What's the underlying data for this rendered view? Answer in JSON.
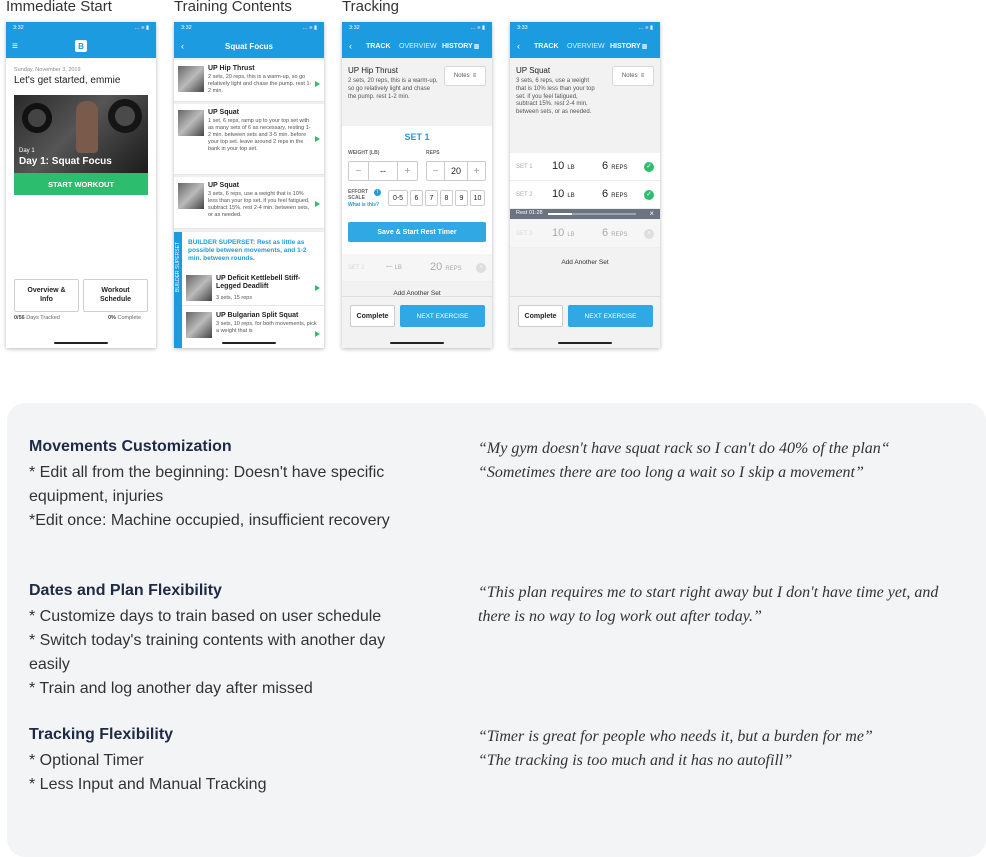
{
  "columns": {
    "col1": "Immediate Start",
    "col2": "Training Contents",
    "col3": "Tracking"
  },
  "status": {
    "time1": "3:32",
    "time2": "3:32",
    "time3": "3:32",
    "time4": "3:33",
    "signal": "… ≡ ▮"
  },
  "phone1": {
    "date": "Sunday, November 3, 2019",
    "greeting": "Let's get started, emmie",
    "day_number": "Day 1",
    "day_title": "Day 1: Squat Focus",
    "start_button": "START WORKOUT",
    "overview_button": "Overview &\nInfo",
    "schedule_button": "Workout\nSchedule",
    "days_tracked_value": "0/56",
    "days_tracked_label": " Days Tracked",
    "complete_value": "0%",
    "complete_label": " Complete"
  },
  "phone2": {
    "title": "Squat Focus",
    "exercises": [
      {
        "name": "UP Hip Thrust",
        "desc": "2 sets, 20 reps, this is a warm-up, so go relatively light and chase the pump. rest 1-2 min."
      },
      {
        "name": "UP Squat",
        "desc": "1 set, 6 reps, ramp up to your top set with as many sets of 6 as necessary, resting 1-2 min. between sets and 3-5 min. before your top set. leave around 2 reps in the bank in your top set."
      },
      {
        "name": "UP Squat",
        "desc": "3 sets, 6 reps, use a weight that is 10% less than your top set. if you feel fatigued, subtract 15%. rest 2-4 min. between sets, or as needed."
      }
    ],
    "superset_side": "BUILDER SUPERSET",
    "superset_header": "BUILDER SUPERSET: Rest as little as possible between movements, and 1-2 min. between rounds.",
    "superset_items": [
      {
        "name": "UP Deficit Kettlebell Stiff-Legged Deadlift",
        "desc": "3 sets, 15 reps"
      },
      {
        "name": "UP Bulgarian Split Squat",
        "desc": "3 sets, 10 reps, for both movements, pick a weight that is"
      }
    ]
  },
  "phone3": {
    "tab_track": "TRACK",
    "tab_overview": "OVERVIEW",
    "tab_history": "HISTORY",
    "exercise_name": "UP Hip Thrust",
    "exercise_desc": "2 sets, 20 reps, this is a warm-up, so go relatively light and chase the pump. rest 1-2 min.",
    "notes": "Notes",
    "set_title": "SET 1",
    "weight_label": "WEIGHT (LB)",
    "reps_label": "REPS",
    "weight_value": "--",
    "reps_value": "20",
    "minus": "−",
    "plus": "+",
    "effort_label": "EFFORT\nSCALE",
    "effort_link": "What is this?",
    "effort_options": [
      "0-5",
      "6",
      "7",
      "8",
      "9",
      "10"
    ],
    "save_button": "Save & Start Rest Timer",
    "set2_label": "SET 2",
    "set2_weight": "--",
    "set2_weight_unit": "LB",
    "set2_reps": "20",
    "set2_reps_unit": "REPS",
    "add_set": "Add Another Set",
    "complete_button": "Complete",
    "next_button": "NEXT EXERCISE"
  },
  "phone4": {
    "tab_track": "TRACK",
    "tab_overview": "OVERVIEW",
    "tab_history": "HISTORY",
    "exercise_name": "UP Squat",
    "exercise_desc": "3 sets, 6 reps, use a weight that is 10% less than your top set. if you feel fatigued, subtract 15%. rest 2-4 min. between sets, or as needed.",
    "notes": "Notes",
    "sets": [
      {
        "label": "SET 1",
        "weight": "10",
        "unit": "LB",
        "reps": "6",
        "reps_unit": "REPS"
      },
      {
        "label": "SET 2",
        "weight": "10",
        "unit": "LB",
        "reps": "6",
        "reps_unit": "REPS"
      },
      {
        "label": "SET 3",
        "weight": "10",
        "unit": "LB",
        "reps": "6",
        "reps_unit": "REPS"
      }
    ],
    "rest_label": "Rest 01:28",
    "rest_progress": 0.27,
    "add_set": "Add Another Set",
    "complete_button": "Complete",
    "next_button": "NEXT EXERCISE"
  },
  "insights": [
    {
      "heading": "Movements Customization",
      "lines": [
        "* Edit all from the beginning: Doesn't have specific equipment, injuries",
        "*Edit once: Machine occupied, insufficient recovery"
      ],
      "quotes": [
        "“My gym doesn't have squat rack so I can't do 40% of the plan“",
        "“Sometimes there are too long a wait so I skip a movement”"
      ]
    },
    {
      "heading": "Dates and Plan Flexibility",
      "lines": [
        "* Customize days to train based on user schedule",
        "* Switch today's training contents with another day easily",
        "* Train and log another day after missed"
      ],
      "quotes": [
        "“This plan requires me to start right away but I don't have time yet, and there is no way to log work out after today.”"
      ]
    },
    {
      "heading": "Tracking Flexibility",
      "lines": [
        "* Optional Timer",
        "* Less Input and Manual Tracking"
      ],
      "quotes": [
        "“Timer is great for people who needs it, but a burden for me”",
        "“The tracking is too much and it has no autofill”"
      ]
    }
  ],
  "colors": {
    "brand_blue": "#1d9be0",
    "green": "#2dbd6e",
    "panel": "#f3f4f6",
    "heading": "#1f2a44"
  }
}
